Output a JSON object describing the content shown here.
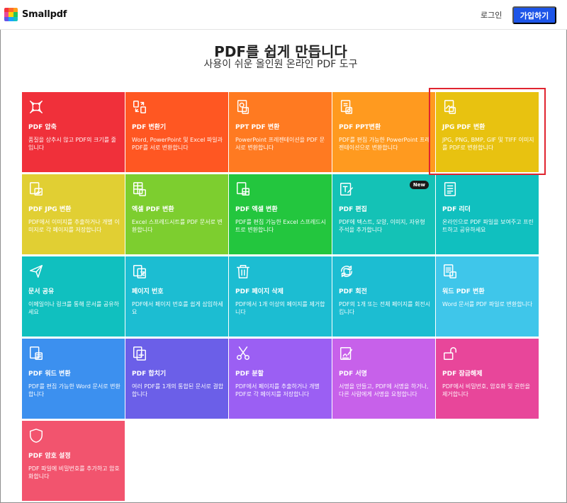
{
  "brand": {
    "name": "Smallpdf",
    "logo_colors": [
      "#f5353e",
      "#ff9e1b",
      "#ffd60a",
      "#22c55e",
      "#1aa3ff",
      "#6554e8",
      "#e84a9a",
      "#13c2c2",
      "#ff6a2b"
    ]
  },
  "header": {
    "login_label": "로그인",
    "signup_label": "가입하기"
  },
  "hero": {
    "title": "PDF를 쉽게 만듭니다",
    "subtitle": "사용이 쉬운 올인원 온라인 PDF 도구"
  },
  "tools": [
    {
      "title": "PDF 압축",
      "desc": "품질을 상추시 않고 PDF의 크기를 줄입니다",
      "icon": "compress-icon",
      "color": "c-red"
    },
    {
      "title": "PDF 변환기",
      "desc": "Word, PowerPoint 및 Excel 파일과 PDF를 서로 변환합니다",
      "icon": "convert-icon",
      "color": "c-orange-red"
    },
    {
      "title": "PPT PDF 변환",
      "desc": "PowerPoint 프레젠테이션을 PDF 문서로 변환합니다",
      "icon": "ppt-to-pdf-icon",
      "color": "c-orange"
    },
    {
      "title": "PDF PPT변환",
      "desc": "PDF를 편집 가능한 PowerPoint 프레젠테이션으로 변환합니다",
      "icon": "pdf-to-ppt-icon",
      "color": "c-amber"
    },
    {
      "title": "JPG PDF 변환",
      "desc": "JPG, PNG, BMP, GIF 및 TIFF 이미지를 PDF로 변환합니다",
      "icon": "jpg-to-pdf-icon",
      "color": "c-yellow"
    },
    {
      "title": "PDF JPG 변환",
      "desc": "PDF에서 이미지를 추출하거나 개별 이미지로 각 페이지를 저장합니다",
      "icon": "pdf-to-jpg-icon",
      "color": "c-lyellow"
    },
    {
      "title": "엑셀 PDF 변환",
      "desc": "Excel 스프레드시트를 PDF 문서로 변환합니다",
      "icon": "excel-to-pdf-icon",
      "color": "c-lgreen"
    },
    {
      "title": "PDF 엑셀 변환",
      "desc": "PDF를 편집 가능한 Excel 스프레드시트로 변환합니다",
      "icon": "pdf-to-excel-icon",
      "color": "c-green"
    },
    {
      "title": "PDF 편집",
      "desc": "PDF에 텍스트, 모양, 이미지, 자유형 주석을 추가합니다",
      "icon": "edit-pdf-icon",
      "color": "c-teal",
      "badge": "New"
    },
    {
      "title": "PDF 리더",
      "desc": "온라인으로 PDF 파일을 보여주고 프린트하고 공유하세요",
      "icon": "pdf-reader-icon",
      "color": "c-teal2"
    },
    {
      "title": "문서 공유",
      "desc": "이메일이나 링크를 통해 문서를 공유하세요",
      "icon": "share-icon",
      "color": "c-teal2"
    },
    {
      "title": "페이지 번호",
      "desc": "PDF에서 페이지 번호를 쉽게 삽입하세요",
      "icon": "page-number-icon",
      "color": "c-cyan"
    },
    {
      "title": "PDF 페이지 삭제",
      "desc": "PDF에서 1개 이상의 페이지를 제거합니다",
      "icon": "trash-icon",
      "color": "c-cyan"
    },
    {
      "title": "PDF 회전",
      "desc": "PDF의 1개 또는 전체 페이지를 회전시킵니다",
      "icon": "rotate-icon",
      "color": "c-cyan"
    },
    {
      "title": "워드 PDF 변환",
      "desc": "Word 문서를 PDF 파일로 변환합니다",
      "icon": "word-to-pdf-icon",
      "color": "c-sky"
    },
    {
      "title": "PDF 워드 변환",
      "desc": "PDF를 편집 가능한 Word 문서로 변환합니다",
      "icon": "pdf-to-word-icon",
      "color": "c-blue"
    },
    {
      "title": "PDF 합치기",
      "desc": "여러 PDF를 1개의 통합된 문서로 결합합니다",
      "icon": "merge-icon",
      "color": "c-indigo"
    },
    {
      "title": "PDF 분할",
      "desc": "PDF에서 페이지를 추출하거나 개별 PDF로 각 페이지를 저장합니다",
      "icon": "scissors-icon",
      "color": "c-purple"
    },
    {
      "title": "PDF 서명",
      "desc": "서명을 만들고, PDF에 서명을 하거나, 다른 사람에게 서명을 요청합니다",
      "icon": "sign-icon",
      "color": "c-violet"
    },
    {
      "title": "PDF 잠금해제",
      "desc": "PDF에서 비밀번호, 암호화 및 권한을 제거합니다",
      "icon": "unlock-icon",
      "color": "c-magenta"
    },
    {
      "title": "PDF 암호 설정",
      "desc": "PDF 파일에 비밀번호를 추가하고 암호화합니다",
      "icon": "shield-icon",
      "color": "c-rose"
    }
  ]
}
